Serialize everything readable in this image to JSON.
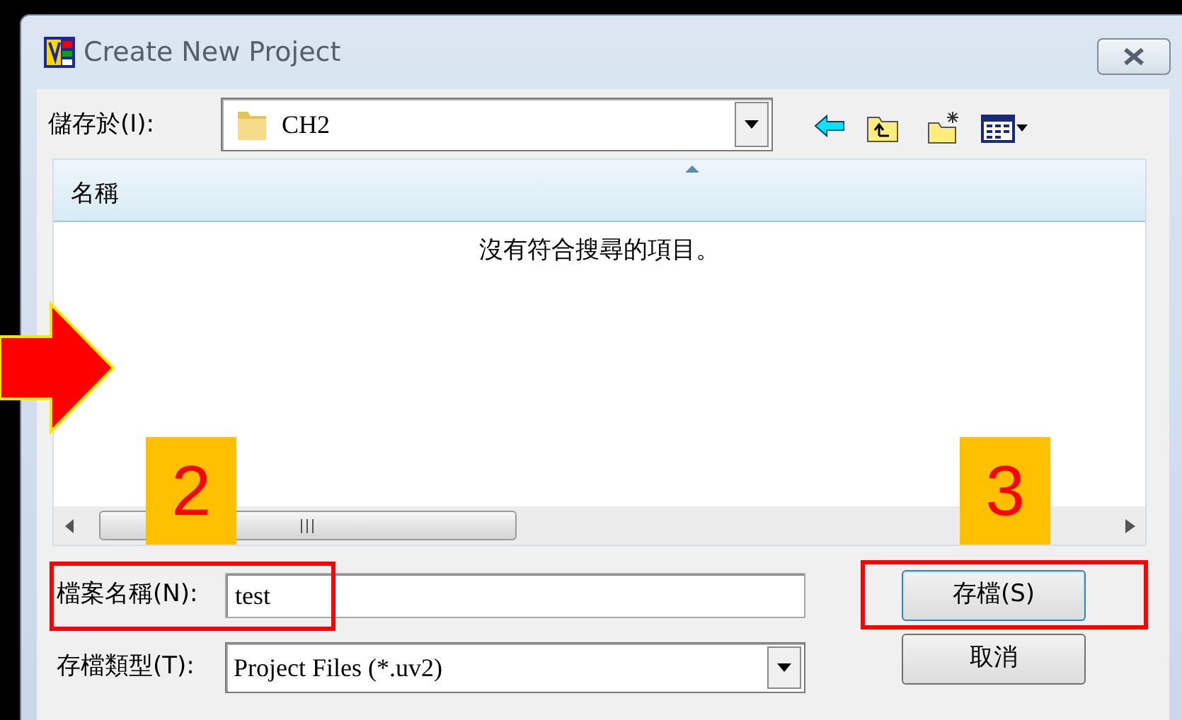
{
  "window": {
    "title": "Create New Project"
  },
  "save_in": {
    "label": "儲存於(I):",
    "value": "CH2"
  },
  "file_list": {
    "columns": [
      {
        "label": "名稱",
        "sorted": true
      }
    ],
    "empty_message": "沒有符合搜尋的項目。"
  },
  "file_name": {
    "label": "檔案名稱(N):",
    "value": "test"
  },
  "file_type": {
    "label": "存檔類型(T):",
    "value": "Project Files (*.uv2)"
  },
  "buttons": [
    {
      "label": "存檔(S)",
      "default": true
    },
    {
      "label": "取消",
      "default": false
    }
  ],
  "annotations": [
    {
      "kind": "arrow"
    },
    {
      "kind": "step",
      "label": "2"
    },
    {
      "kind": "step",
      "label": "3"
    },
    {
      "kind": "frame"
    },
    {
      "kind": "frame"
    }
  ]
}
